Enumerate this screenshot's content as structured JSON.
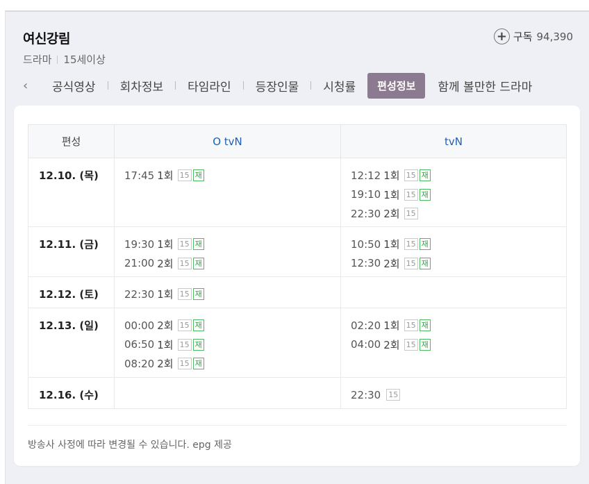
{
  "show": {
    "title": "여신강림",
    "genre": "드라마",
    "rating": "15세이상",
    "subscribe_label": "구독",
    "subscribe_count": "94,390"
  },
  "tabs": [
    {
      "label": "공식영상",
      "active": false
    },
    {
      "label": "회차정보",
      "active": false
    },
    {
      "label": "타임라인",
      "active": false
    },
    {
      "label": "등장인물",
      "active": false
    },
    {
      "label": "시청률",
      "active": false
    },
    {
      "label": "편성정보",
      "active": true
    },
    {
      "label": "함께 볼만한 드라마",
      "active": false
    }
  ],
  "schedule": {
    "header": {
      "col0": "편성",
      "col1": "O tvN",
      "col2": "tvN"
    },
    "rows": [
      {
        "date": "12.10. (목)",
        "ch1": [
          {
            "time": "17:45",
            "ep": "1회",
            "age": "15",
            "rerun": "재"
          }
        ],
        "ch2": [
          {
            "time": "12:12",
            "ep": "1회",
            "age": "15",
            "rerun": "재"
          },
          {
            "time": "19:10",
            "ep": "1회",
            "age": "15",
            "rerun": "재"
          },
          {
            "time": "22:30",
            "ep": "2회",
            "age": "15",
            "rerun": ""
          }
        ]
      },
      {
        "date": "12.11. (금)",
        "ch1": [
          {
            "time": "19:30",
            "ep": "1회",
            "age": "15",
            "rerun": "재"
          },
          {
            "time": "21:00",
            "ep": "2회",
            "age": "15",
            "rerun": "재"
          }
        ],
        "ch2": [
          {
            "time": "10:50",
            "ep": "1회",
            "age": "15",
            "rerun": "재"
          },
          {
            "time": "12:30",
            "ep": "2회",
            "age": "15",
            "rerun": "재"
          }
        ]
      },
      {
        "date": "12.12. (토)",
        "ch1": [
          {
            "time": "22:30",
            "ep": "1회",
            "age": "15",
            "rerun": "재"
          }
        ],
        "ch2": []
      },
      {
        "date": "12.13. (일)",
        "ch1": [
          {
            "time": "00:00",
            "ep": "2회",
            "age": "15",
            "rerun": "재"
          },
          {
            "time": "06:50",
            "ep": "1회",
            "age": "15",
            "rerun": "재"
          },
          {
            "time": "08:20",
            "ep": "2회",
            "age": "15",
            "rerun": "재"
          }
        ],
        "ch2": [
          {
            "time": "02:20",
            "ep": "1회",
            "age": "15",
            "rerun": "재"
          },
          {
            "time": "04:00",
            "ep": "2회",
            "age": "15",
            "rerun": "재"
          }
        ]
      },
      {
        "date": "12.16. (수)",
        "ch1": [],
        "ch2": [
          {
            "time": "22:30",
            "ep": "",
            "age": "15",
            "rerun": ""
          }
        ]
      }
    ]
  },
  "footer_note": "방송사 사정에 따라 변경될 수 있습니다. epg 제공",
  "icons": {
    "subscribe": "plus-circle-icon",
    "tabs_prev": "chevron-left-icon"
  },
  "colors": {
    "active_tab": "#8c7a90",
    "channel_header": "#1f5fb5",
    "rerun": "#33a14a"
  }
}
